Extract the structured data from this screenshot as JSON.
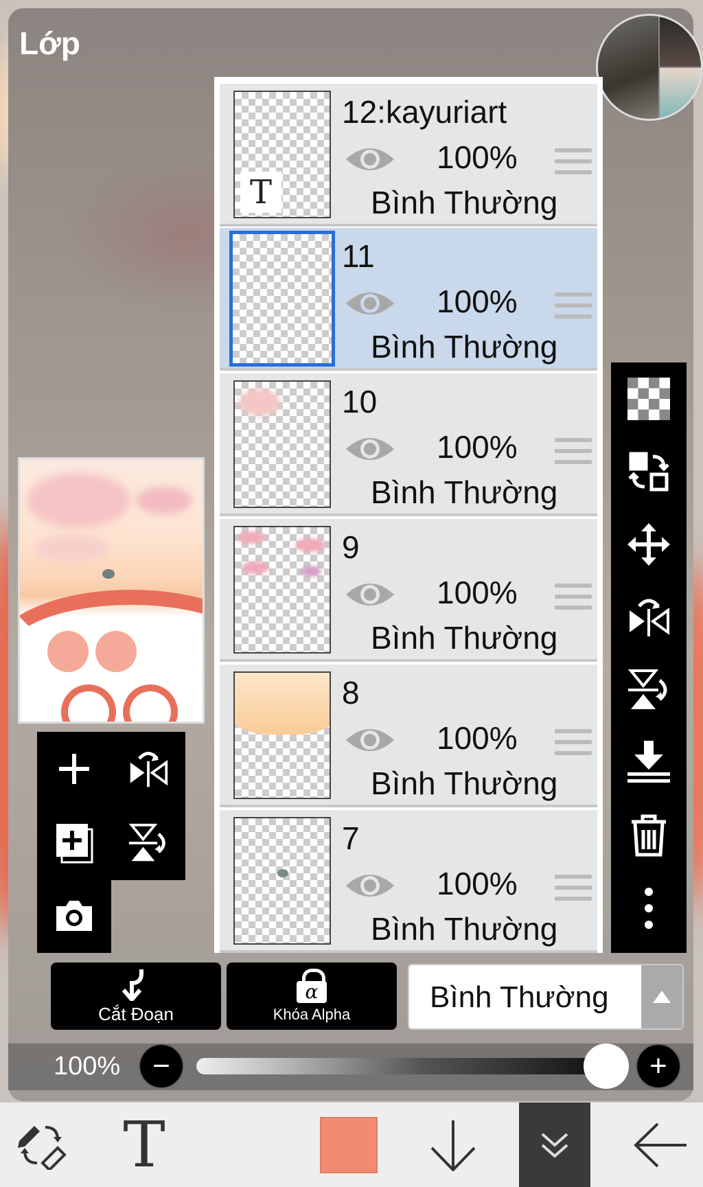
{
  "header": {
    "title": "Lớp"
  },
  "layers": [
    {
      "name": "12:kayuriart",
      "opacity": "100%",
      "mode": "Bình Thường",
      "selected": false
    },
    {
      "name": "11",
      "opacity": "100%",
      "mode": "Bình Thường",
      "selected": true
    },
    {
      "name": "10",
      "opacity": "100%",
      "mode": "Bình Thường",
      "selected": false
    },
    {
      "name": "9",
      "opacity": "100%",
      "mode": "Bình Thường",
      "selected": false
    },
    {
      "name": "8",
      "opacity": "100%",
      "mode": "Bình Thường",
      "selected": false
    },
    {
      "name": "7",
      "opacity": "100%",
      "mode": "Bình Thường",
      "selected": false
    }
  ],
  "text_layer_glyph": "T",
  "right_toolbar": [
    "transparency-icon",
    "swap-layer-icon",
    "move-icon",
    "flip-horizontal-icon",
    "flip-vertical-icon",
    "merge-down-icon",
    "trash-icon",
    "more-icon"
  ],
  "left_toolbar": [
    "add-layer-icon",
    "flip-horizontal-icon",
    "add-paper-layer-icon",
    "flip-vertical-icon",
    "camera-icon"
  ],
  "buttons": {
    "clip": "Cắt Đoạn",
    "alpha_lock": "Khóa Alpha",
    "alpha_glyph": "α"
  },
  "blend_mode": {
    "value": "Bình Thường"
  },
  "opacity_slider": {
    "label": "100%",
    "value": 1.0,
    "minus": "−",
    "plus": "+"
  },
  "bottom_bar": {
    "text_tool": "T",
    "color": "#f28b73",
    "items": [
      "pen-eraser-swap-icon",
      "text-icon",
      "color-swatch",
      "down-arrow-icon",
      "collapse-icon",
      "back-arrow-icon"
    ]
  },
  "colors": {
    "selected_layer": "#c9d8ea",
    "selection_border": "#2a6fd6",
    "brush": "#f28b73"
  }
}
